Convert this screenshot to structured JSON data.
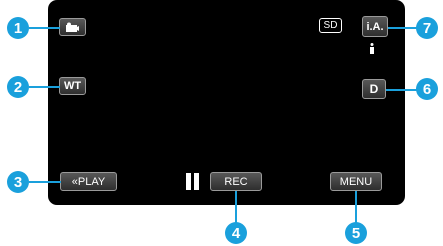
{
  "callouts": [
    "1",
    "2",
    "3",
    "4",
    "5",
    "6",
    "7"
  ],
  "screen": {
    "media_label": "SD",
    "wt_label": "WT",
    "play_label": "«PLAY",
    "rec_label": "REC",
    "menu_label": "MENU",
    "d_label": "D",
    "ia_label": "i.A."
  },
  "icons": {
    "mode": "video-camera-icon",
    "pause": "pause-icon",
    "scene": "person-icon"
  },
  "colors": {
    "callout": "#1aa0dc",
    "screen": "#000000",
    "button_border": "#9a9a9a"
  }
}
